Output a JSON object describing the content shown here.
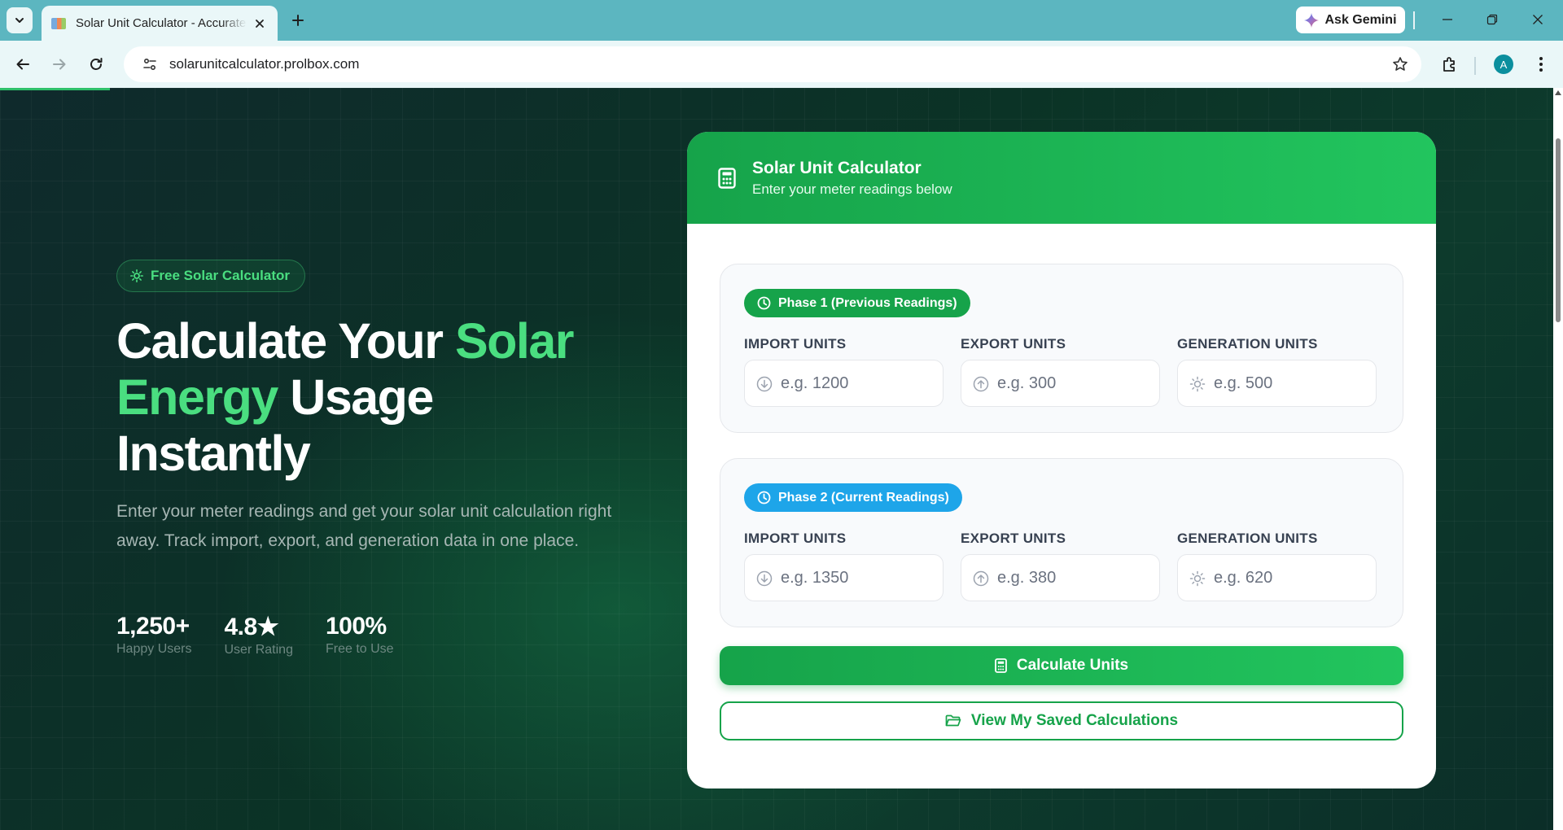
{
  "browser": {
    "tab_title": "Solar Unit Calculator - Accurate Solar Energy Calculations",
    "url": "solarunitcalculator.prolbox.com",
    "ask_gemini": "Ask Gemini",
    "avatar_initial": "A"
  },
  "hero": {
    "badge": "Free Solar Calculator",
    "headline_part1": "Calculate Your ",
    "headline_accent": "Solar Energy",
    "headline_part2": " Usage Instantly",
    "lead": "Enter your meter readings and get your solar unit calculation right away. Track import, export, and generation data in one place.",
    "stats": [
      {
        "value": "1,250+",
        "label": "Happy Users"
      },
      {
        "value": "4.8★",
        "label": "User Rating"
      },
      {
        "value": "100%",
        "label": "Free to Use"
      }
    ]
  },
  "calculator": {
    "title": "Solar Unit Calculator",
    "subtitle": "Enter your meter readings below",
    "phase1": {
      "tag": "Phase 1 (Previous Readings)",
      "import_label": "IMPORT UNITS",
      "import_placeholder": "e.g. 1200",
      "export_label": "EXPORT UNITS",
      "export_placeholder": "e.g. 300",
      "generation_label": "GENERATION UNITS",
      "generation_placeholder": "e.g. 500"
    },
    "phase2": {
      "tag": "Phase 2 (Current Readings)",
      "import_label": "IMPORT UNITS",
      "import_placeholder": "e.g. 1350",
      "export_label": "EXPORT UNITS",
      "export_placeholder": "e.g. 380",
      "generation_label": "GENERATION UNITS",
      "generation_placeholder": "e.g. 620"
    },
    "calculate_button": "Calculate Units",
    "saved_button": "View My Saved Calculations"
  },
  "colors": {
    "accent_green": "#4ade80",
    "primary_green": "#16a34a",
    "phase2_blue": "#1ea5e9",
    "tabbar": "#5cb6c0"
  }
}
